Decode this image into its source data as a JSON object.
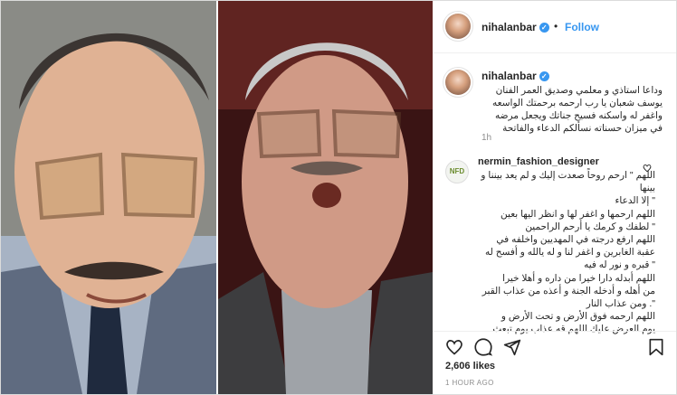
{
  "post": {
    "username": "nihalanbar",
    "follow_label": "Follow",
    "separator": "•",
    "caption": "وداعا استاذي و معلمي وصديق العمر الفنان يوسف شعبان يا رب ارحمه برحمتك الواسعه واغفر له واسكنه فسيح جناتك ويجعل مرضه في ميزان حسناته نسألكم الدعاء والفاتحة",
    "caption_time": "1h",
    "likes": "2,606 likes",
    "time_ago": "1 HOUR AGO"
  },
  "comment": {
    "username": "nermin_fashion_designer",
    "avatar_text": "NFD",
    "lines": [
      "اللهم \" ارحم روحاً صعدت إليك و لم يعد بيننا و بينها",
      "\" إلا الدعاء",
      "اللهم ارحمها و اغفر لها و انظر اليها بعين",
      "\" لطفك و كرمك يا أرحم الراحمين",
      "اللهم ارفع درجته في المهديين واخلفه في",
      "عقبة الغابرين و اغفر لنا و له يالله و أفسح له",
      "\" قبره و نور له فيه",
      "اللهم أبدله دارا خيرا من داره و أهلا خيرا",
      "من أهله و أدخله الجنة و أعذه من عذاب القبر",
      "\". ومن عذاب النار",
      "اللهم ارحمه فوق الأرض و تحت الأرض و",
      "يوم العرض عليك اللهم قه عذاب يوم تبعث"
    ]
  },
  "icons": {
    "verified": "verified-badge-icon",
    "heart": "heart-icon",
    "comment": "comment-icon",
    "share": "share-icon",
    "bookmark": "bookmark-icon"
  },
  "colors": {
    "link_blue": "#3897f0",
    "text": "#262626",
    "muted": "#8e8e8e"
  }
}
